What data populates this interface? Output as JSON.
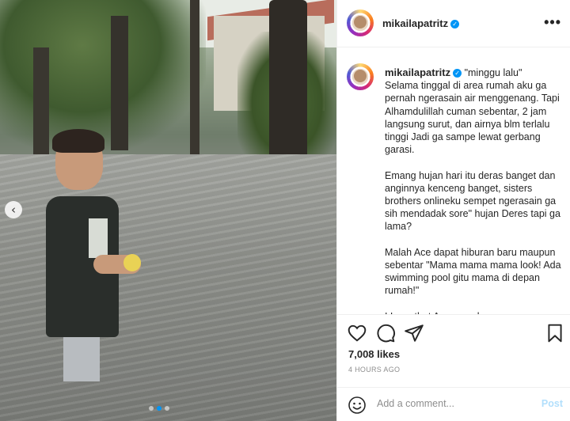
{
  "post": {
    "username": "mikailapatritz",
    "verified_mark": "✓",
    "caption": "\"minggu lalu\"\nSelama tinggal di area rumah aku ga pernah ngerasain air menggenang. Tapi Alhamdulillah cuman sebentar, 2 jam langsung surut, dan airnya blm terlalu tinggi Jadi ga sampe lewat gerbang garasi.\n\nEmang hujan hari itu deras banget dan anginnya kenceng banget, sisters brothers onlineku sempet ngerasain ga sih mendadak sore\" hujan Deres tapi ga lama?\n\nMalah Ace dapat hiburan baru maupun sebentar \"Mama mama mama look! Ada swimming pool gitu mama di depan rumah!\"\n\nI Love that Ace can always see a",
    "likes": "7,008 likes",
    "time": "4 HOURS AGO"
  },
  "header": {
    "more_label": "•••"
  },
  "carousel": {
    "prev_glyph": "‹",
    "dot_count": 3,
    "active_dot": 1
  },
  "comment": {
    "placeholder": "Add a comment...",
    "post_label": "Post"
  },
  "icons": [
    "heart-icon",
    "comment-icon",
    "share-icon",
    "bookmark-icon",
    "emoji-icon",
    "verified-icon",
    "more-icon",
    "chevron-left-icon"
  ],
  "colors": {
    "accent": "#0095f6",
    "text": "#262626",
    "muted": "#8e8e8e",
    "border": "#efefef",
    "post_disabled": "#b2dffc"
  }
}
